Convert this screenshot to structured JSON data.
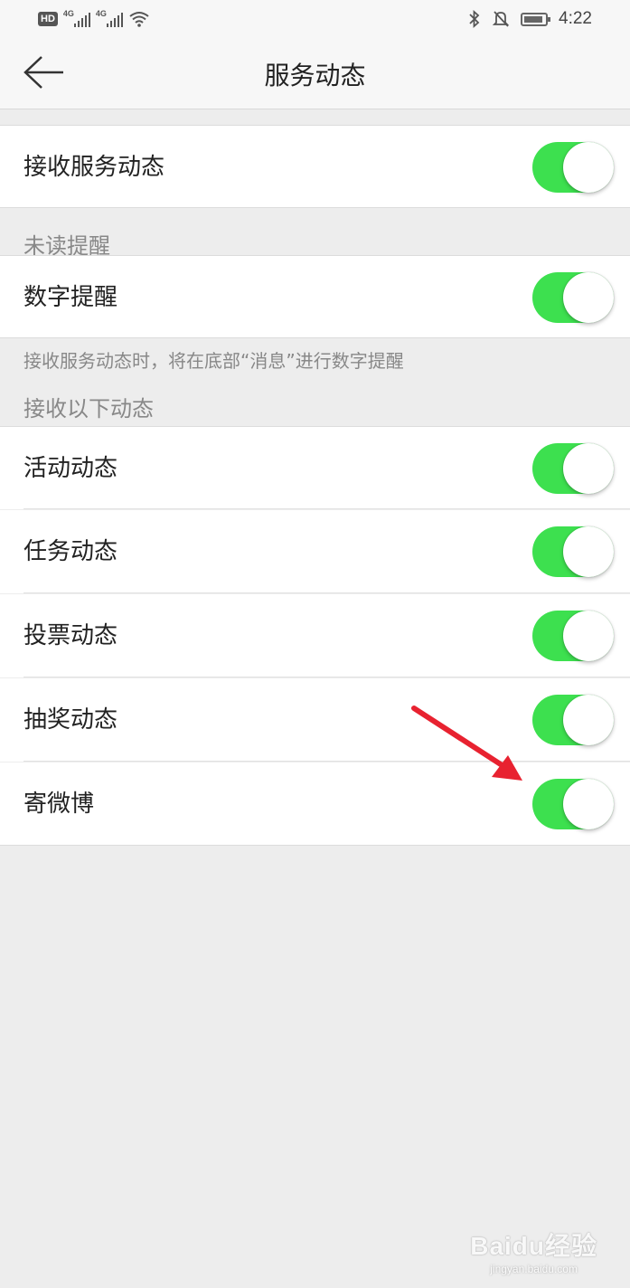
{
  "status_bar": {
    "network_badge": "HD",
    "signal1_tag": "4G",
    "signal2_tag": "4G",
    "time": "4:22",
    "icons": [
      "wifi-icon",
      "bluetooth-icon",
      "bell-off-icon",
      "battery-icon"
    ]
  },
  "nav": {
    "title": "服务动态",
    "back_icon": "arrow-left-icon"
  },
  "main_toggle": {
    "label": "接收服务动态",
    "on": true
  },
  "unread_section": {
    "title": "未读提醒",
    "item": {
      "label": "数字提醒",
      "on": true
    },
    "hint": "接收服务动态时，将在底部“消息”进行数字提醒"
  },
  "receive_section": {
    "title": "接收以下动态",
    "items": [
      {
        "label": "活动动态",
        "on": true
      },
      {
        "label": "任务动态",
        "on": true
      },
      {
        "label": "投票动态",
        "on": true
      },
      {
        "label": "抽奖动态",
        "on": true
      },
      {
        "label": "寄微博",
        "on": true
      }
    ]
  },
  "colors": {
    "toggle_on": "#3de04f",
    "annotation_arrow": "#e82230",
    "background": "#ededed"
  },
  "watermark": {
    "main": "Baidu经验",
    "sub": "jingyan.baidu.com"
  }
}
